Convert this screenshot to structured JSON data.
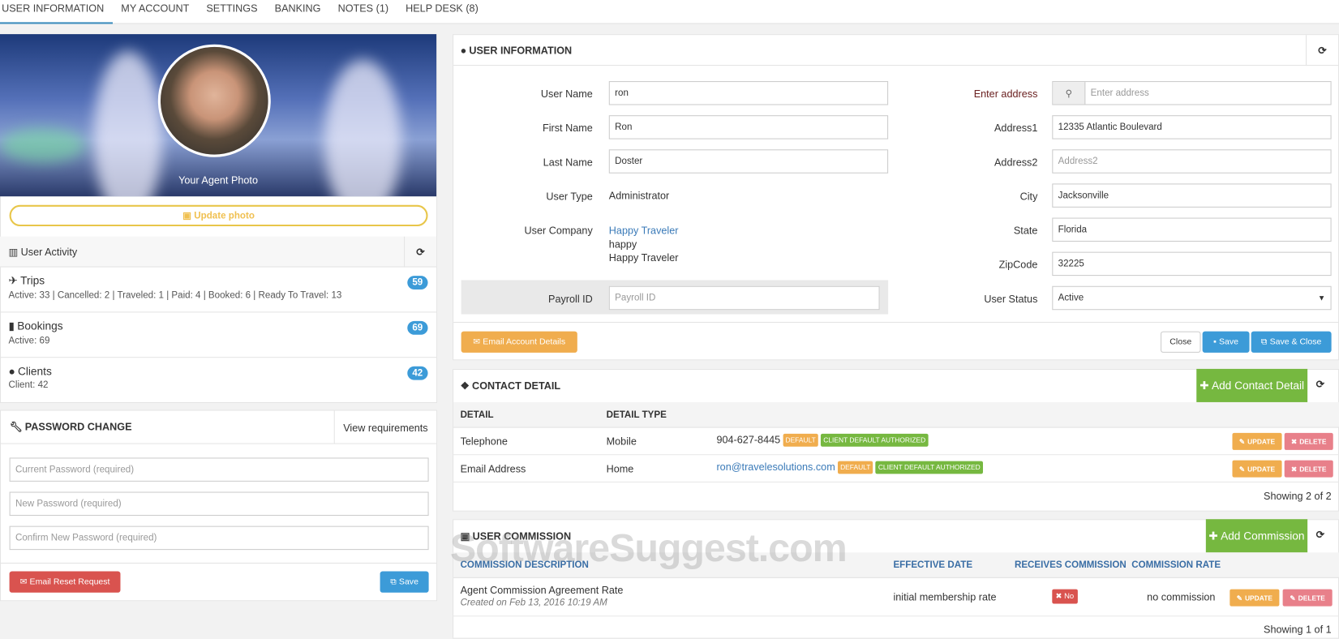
{
  "tabs": [
    "USER INFORMATION",
    "MY ACCOUNT",
    "SETTINGS",
    "BANKING",
    "NOTES (1)",
    "HELP DESK (8)"
  ],
  "profile": {
    "caption": "Your Agent Photo",
    "update_photo": "Update photo"
  },
  "activity": {
    "title": "User Activity",
    "items": [
      {
        "title": "Trips",
        "count": "59",
        "detail": "Active: 33 | Cancelled: 2 | Traveled: 1 | Paid: 4 | Booked: 6 | Ready To Travel: 13"
      },
      {
        "title": "Bookings",
        "count": "69",
        "detail": "Active: 69"
      },
      {
        "title": "Clients",
        "count": "42",
        "detail": "Client: 42"
      }
    ]
  },
  "password": {
    "title": "PASSWORD CHANGE",
    "view_requirements": "View requirements",
    "current_ph": "Current Password (required)",
    "new_ph": "New Password (required)",
    "confirm_ph": "Confirm New Password (required)",
    "email_reset": "Email Reset Request",
    "save": "Save"
  },
  "user_info": {
    "title": "USER INFORMATION",
    "labels": {
      "username": "User Name",
      "first": "First Name",
      "last": "Last Name",
      "type": "User Type",
      "company": "User Company",
      "payroll": "Payroll ID",
      "enter_address": "Enter address",
      "address1": "Address1",
      "address2": "Address2",
      "city": "City",
      "state": "State",
      "zip": "ZipCode",
      "status": "User Status"
    },
    "values": {
      "username": "ron",
      "first": "Ron",
      "last": "Doster",
      "type": "Administrator",
      "company_link": "Happy Traveler",
      "company_line2": "happy",
      "company_line3": "Happy Traveler",
      "address1": "12335 Atlantic Boulevard",
      "city": "Jacksonville",
      "state": "Florida",
      "zip": "32225",
      "status": "Active"
    },
    "placeholders": {
      "payroll": "Payroll ID",
      "enter_address": "Enter address",
      "address2": "Address2"
    },
    "buttons": {
      "email_account": "Email Account Details",
      "close": "Close",
      "save": "Save",
      "save_close": "Save & Close"
    }
  },
  "contact": {
    "title": "CONTACT DETAIL",
    "add": "Add Contact Detail",
    "headers": [
      "DETAIL",
      "DETAIL TYPE"
    ],
    "rows": [
      {
        "detail": "Telephone",
        "type": "Mobile",
        "value": "904-627-8445",
        "tag1": "DEFAULT",
        "tag2": "CLIENT DEFAULT AUTHORIZED"
      },
      {
        "detail": "Email Address",
        "type": "Home",
        "value": "ron@travelesolutions.com",
        "tag1": "DEFAULT",
        "tag2": "CLIENT DEFAULT AUTHORIZED"
      }
    ],
    "update": "UPDATE",
    "delete": "DELETE",
    "showing": "Showing 2 of 2"
  },
  "commission": {
    "title": "USER COMMISSION",
    "add": "Add Commission",
    "headers": [
      "COMMISSION DESCRIPTION",
      "EFFECTIVE DATE",
      "RECEIVES COMMISSION",
      "COMMISSION RATE"
    ],
    "row": {
      "desc": "Agent Commission Agreement Rate",
      "created": "Created on Feb 13, 2016 10:19 AM",
      "date": "initial membership rate",
      "receives": "No",
      "rate": "no commission"
    },
    "update": "UPDATE",
    "delete": "DELETE",
    "showing": "Showing 1 of 1"
  },
  "watermark": "SoftwareSuggest.com"
}
